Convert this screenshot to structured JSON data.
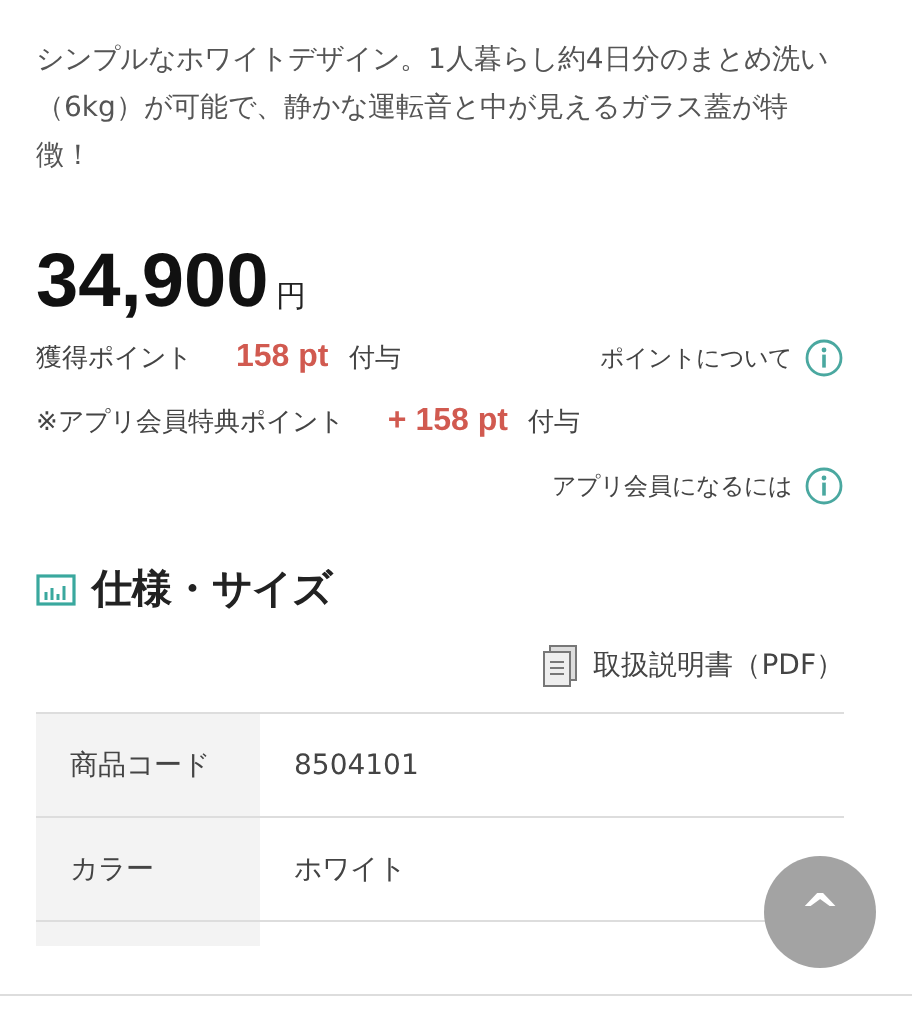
{
  "description": "シンプルなホワイトデザイン。1人暮らし約4日分のまとめ洗い（6kg）が可能で、静かな運転音と中が見えるガラス蓋が特徴！",
  "price": {
    "amount": "34,900",
    "unit": "円"
  },
  "points": [
    {
      "label": "獲得ポイント",
      "value": "158 pt",
      "suffix": "付与",
      "link": "ポイントについて"
    },
    {
      "label": "※アプリ会員特典ポイント",
      "value": "+ 158 pt",
      "suffix": "付与"
    }
  ],
  "member_link": "アプリ会員になるには",
  "section": {
    "title": "仕様・サイズ",
    "manual_link": "取扱説明書（PDF）"
  },
  "specs": [
    {
      "label": "商品コード",
      "value": "8504101"
    },
    {
      "label": "カラー",
      "value": "ホワイト"
    }
  ],
  "scroll_top": "^"
}
